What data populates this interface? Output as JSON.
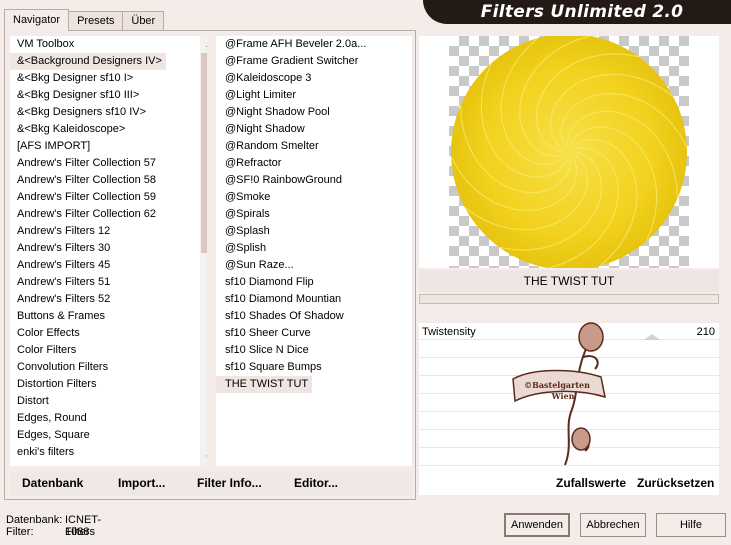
{
  "app": {
    "logo_text": "Filters Unlimited 2.0"
  },
  "tabs": [
    {
      "label": "Navigator",
      "active": true
    },
    {
      "label": "Presets",
      "active": false
    },
    {
      "label": "Über",
      "active": false
    }
  ],
  "categories": {
    "items": [
      "VM Toolbox",
      "&<Background Designers IV>",
      "&<Bkg Designer sf10 I>",
      "&<Bkg Designer sf10 III>",
      "&<Bkg Designers sf10 IV>",
      "&<Bkg Kaleidoscope>",
      "[AFS IMPORT]",
      "Andrew's Filter Collection 57",
      "Andrew's Filter Collection 58",
      "Andrew's Filter Collection 59",
      "Andrew's Filter Collection 62",
      "Andrew's Filters 12",
      "Andrew's Filters 30",
      "Andrew's Filters 45",
      "Andrew's Filters 51",
      "Andrew's Filters 52",
      "Buttons & Frames",
      "Color Effects",
      "Color Filters",
      "Convolution Filters",
      "Distortion Filters",
      "Distort",
      "Edges, Round",
      "Edges, Square",
      "enki's filters"
    ],
    "selected_index": 1,
    "scroll_up_icon": "arrow-up-icon",
    "scroll_down_icon": "arrow-down-icon"
  },
  "filters": {
    "items": [
      "@Frame AFH Beveler 2.0a...",
      "@Frame Gradient Switcher",
      "@Kaleidoscope 3",
      "@Light Limiter",
      "@Night Shadow Pool",
      "@Night Shadow",
      "@Random Smelter",
      "@Refractor",
      "@SF!0 RainbowGround",
      "@Smoke",
      "@Spirals",
      "@Splash",
      "@Splish",
      "@Sun Raze...",
      "sf10 Diamond Flip",
      "sf10 Diamond Mountian",
      "sf10 Shades Of Shadow",
      "sf10 Sheer Curve",
      "sf10 Slice N Dice",
      "sf10 Square Bumps",
      "THE TWIST TUT"
    ],
    "selected_index": 20
  },
  "list_buttons": {
    "database": "Datenbank",
    "import": "Import...",
    "filter_info": "Filter Info...",
    "editor": "Editor..."
  },
  "preview": {
    "filter_name": "THE TWIST TUT"
  },
  "params": [
    {
      "label": "Twistensity",
      "value": "210",
      "level": 0.82
    }
  ],
  "watermark": {
    "line1": "©Bastelgarten",
    "line2": "Wien"
  },
  "param_buttons": {
    "random": "Zufallswerte",
    "reset": "Zurücksetzen"
  },
  "status": {
    "database_label": "Datenbank:",
    "database_value": "ICNET-Filters",
    "filter_label": "Filter:",
    "filter_value": "1088"
  },
  "dialog_buttons": {
    "apply": "Anwenden",
    "cancel": "Abbrechen",
    "help": "Hilfe"
  },
  "colors": {
    "window_bg": "#f3ece9",
    "logo_bar": "#231a16",
    "selection": "#efe6e3",
    "scroll_thumb": "#dcc6c0",
    "preview_yellow": "#f2d21e",
    "watermark_ink": "#5a2a1c"
  }
}
